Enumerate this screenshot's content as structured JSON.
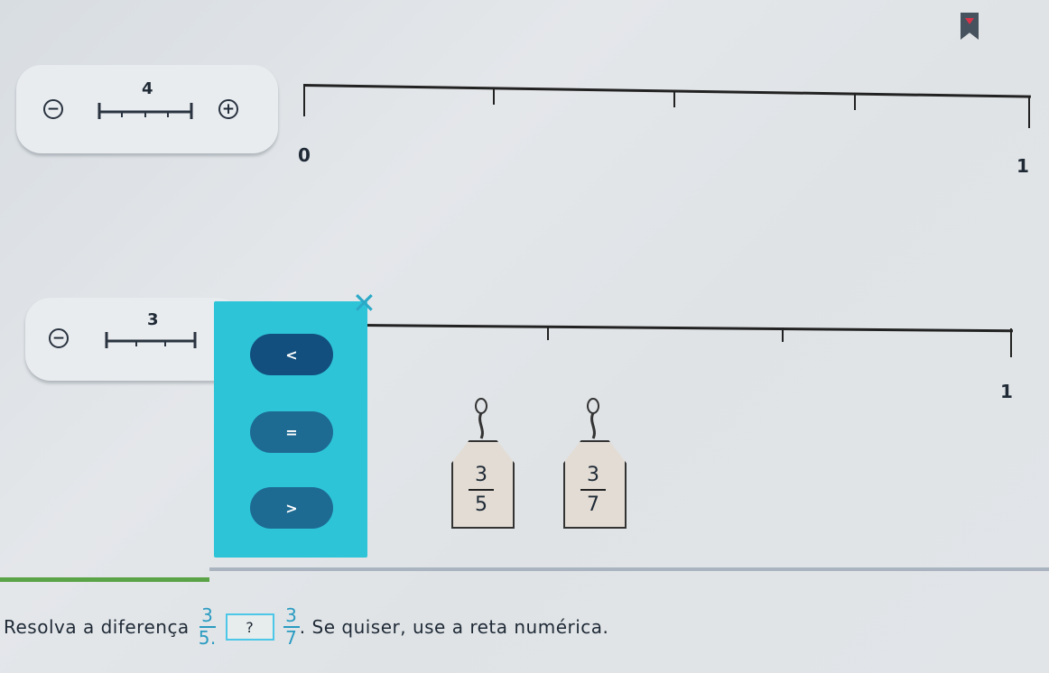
{
  "number_line_top": {
    "segment_count": "4",
    "minus_icon": "−",
    "plus_icon": "+",
    "label_start": "0",
    "label_end": "1",
    "divisions": 4
  },
  "number_line_bottom": {
    "segment_count": "3",
    "minus_icon": "−",
    "label_end": "1",
    "divisions": 3
  },
  "comparison": {
    "close_icon": "✕",
    "less": "<",
    "equal": "=",
    "greater": ">"
  },
  "tags": [
    {
      "numerator": "3",
      "denominator": "5"
    },
    {
      "numerator": "3",
      "denominator": "7"
    }
  ],
  "footer": {
    "prefix": "Resolva a diferença",
    "frac1_num": "3",
    "frac1_den": "5.",
    "answer_glyph": "?",
    "frac2_num": "3",
    "frac2_den": "7",
    "suffix": ". Se quiser, use a reta numérica."
  },
  "colors": {
    "panel": "#2ec4d8",
    "button": "#1d6a93",
    "accent_fraction": "#2a9bc1",
    "progress_green": "#5aa346"
  }
}
